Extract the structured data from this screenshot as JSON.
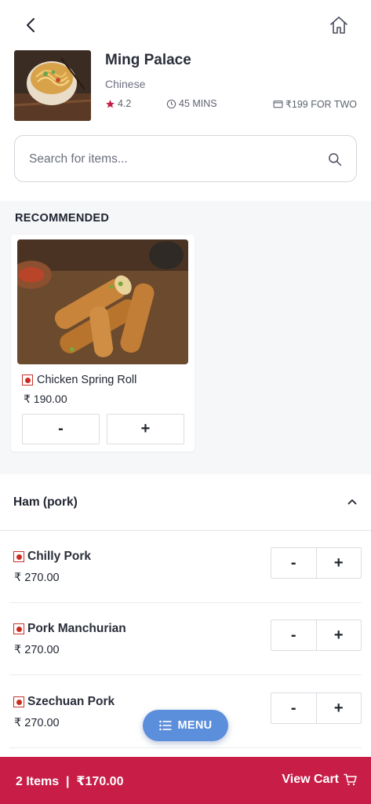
{
  "restaurant": {
    "name": "Ming Palace",
    "cuisine": "Chinese",
    "rating": "4.2",
    "time": "45 MINS",
    "cost": "₹199 FOR TWO"
  },
  "search": {
    "placeholder": "Search for items..."
  },
  "recommended": {
    "title": "RECOMMENDED",
    "items": [
      {
        "name": "Chicken Spring Roll",
        "price": "₹ 190.00",
        "minus": "-",
        "plus": "+"
      }
    ]
  },
  "section": {
    "title": "Ham (pork)",
    "items": [
      {
        "name": "Chilly Pork",
        "price": "₹ 270.00",
        "minus": "-",
        "plus": "+"
      },
      {
        "name": "Pork Manchurian",
        "price": "₹ 270.00",
        "minus": "-",
        "plus": "+"
      },
      {
        "name": "Szechuan Pork",
        "price": "₹ 270.00",
        "minus": "-",
        "plus": "+"
      }
    ]
  },
  "menu_button": {
    "label": "MENU"
  },
  "cart": {
    "summary": "2 Items  |  ₹170.00",
    "view_label": "View Cart"
  },
  "colors": {
    "accent": "#c71d47",
    "menu": "#5b8edb",
    "nonveg": "#cc2a20"
  }
}
